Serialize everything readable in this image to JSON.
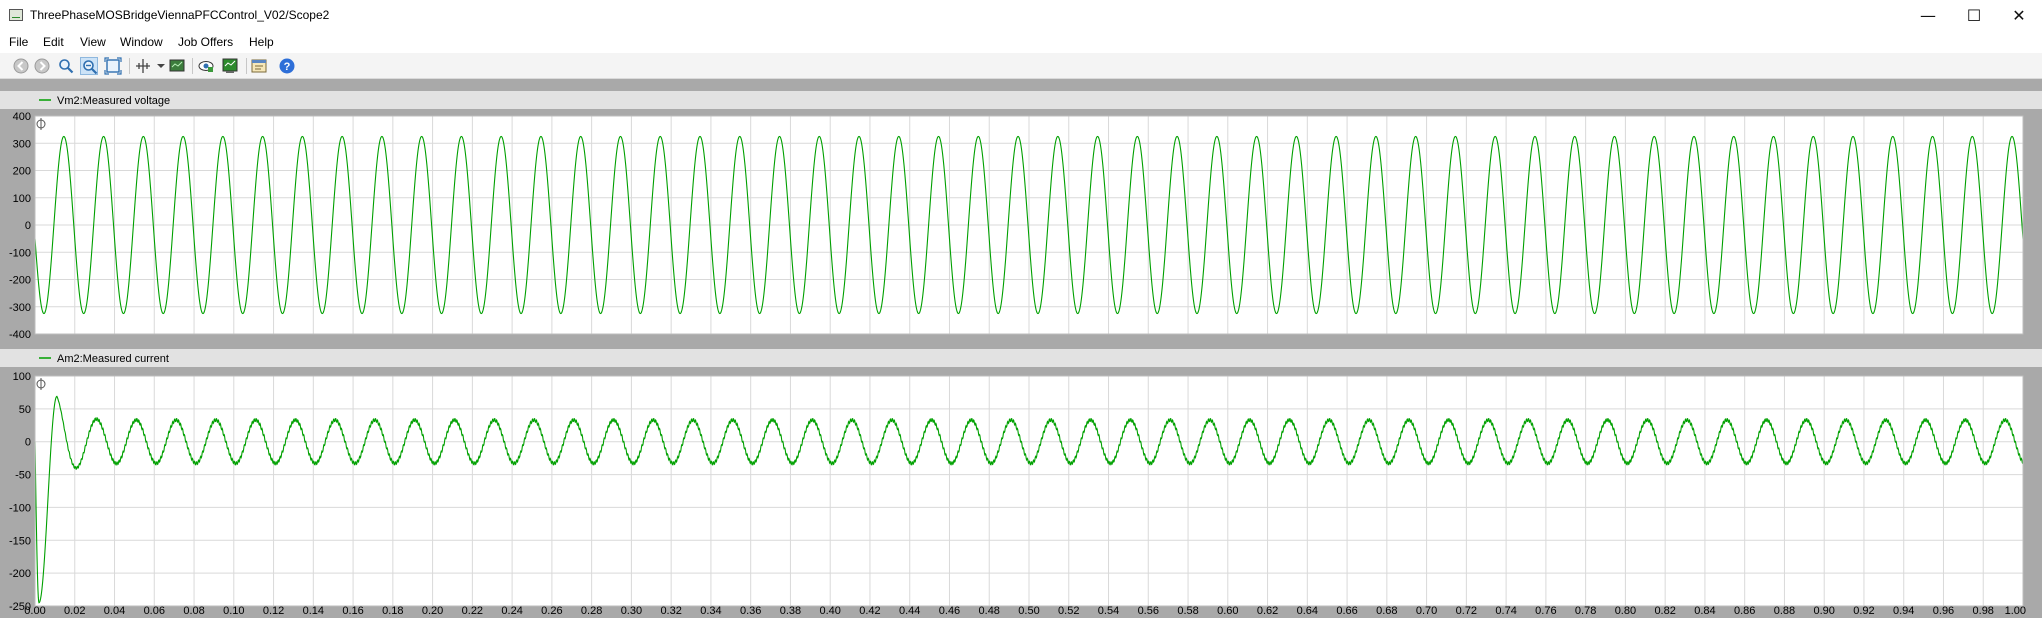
{
  "window": {
    "title": "ThreePhaseMOSBridgeViennaPFCControl_V02/Scope2",
    "minimize_glyph": "—",
    "maximize_glyph": "☐",
    "close_glyph": "✕"
  },
  "menu": [
    "File",
    "Edit",
    "View",
    "Window",
    "Job Offers",
    "Help"
  ],
  "toolbar": {
    "icons": [
      "back-icon",
      "forward-icon",
      "zoom-icon",
      "zoom-x-icon",
      "zoom-fit-icon",
      "axes-icon",
      "dropdown-icon",
      "screen-icon",
      "view-icon",
      "display-icon",
      "properties-icon",
      "help-icon"
    ],
    "active": [
      "zoom-x-icon"
    ]
  },
  "colors": {
    "trace": "#00a000",
    "background": "#a9a9a9",
    "legend_bar": "#e2e2e2",
    "grid": "#d9d9d9"
  },
  "chart_data": [
    {
      "type": "line",
      "series": [
        {
          "name": "Vm2:Measured voltage",
          "waveform": "sine",
          "amplitude": 325,
          "frequency_hz": 50,
          "phase_at_t0": "-0.95",
          "x_start": 0,
          "x_end": 1
        }
      ],
      "xlim": [
        0,
        1
      ],
      "ylim": [
        -400,
        400
      ],
      "yticks": [
        "400",
        "300",
        "200",
        "100",
        "0",
        "-100",
        "-200",
        "-300",
        "-400"
      ],
      "grid": true,
      "legend": "top-left"
    },
    {
      "type": "line",
      "series": [
        {
          "name": "Am2:Measured current",
          "waveform": "sine with startup transient",
          "amplitude": 33,
          "frequency_hz": 50,
          "startup_min": -245,
          "startup_min_t": 0.002,
          "startup_max": 69,
          "startup_max_t": 0.011,
          "x_start": 0,
          "x_end": 1
        }
      ],
      "xlim": [
        0,
        1
      ],
      "ylim": [
        -250,
        100
      ],
      "yticks": [
        "100",
        "50",
        "0",
        "-50",
        "-100",
        "-150",
        "-200",
        "-250"
      ],
      "xticks": [
        "0.00",
        "0.02",
        "0.04",
        "0.06",
        "0.08",
        "0.10",
        "0.12",
        "0.14",
        "0.16",
        "0.18",
        "0.20",
        "0.22",
        "0.24",
        "0.26",
        "0.28",
        "0.30",
        "0.32",
        "0.34",
        "0.36",
        "0.38",
        "0.40",
        "0.42",
        "0.44",
        "0.46",
        "0.48",
        "0.50",
        "0.52",
        "0.54",
        "0.56",
        "0.58",
        "0.60",
        "0.62",
        "0.64",
        "0.66",
        "0.68",
        "0.70",
        "0.72",
        "0.74",
        "0.76",
        "0.78",
        "0.80",
        "0.82",
        "0.84",
        "0.86",
        "0.88",
        "0.90",
        "0.92",
        "0.94",
        "0.96",
        "0.98",
        "1.00"
      ],
      "grid": true,
      "legend": "top-left"
    }
  ]
}
